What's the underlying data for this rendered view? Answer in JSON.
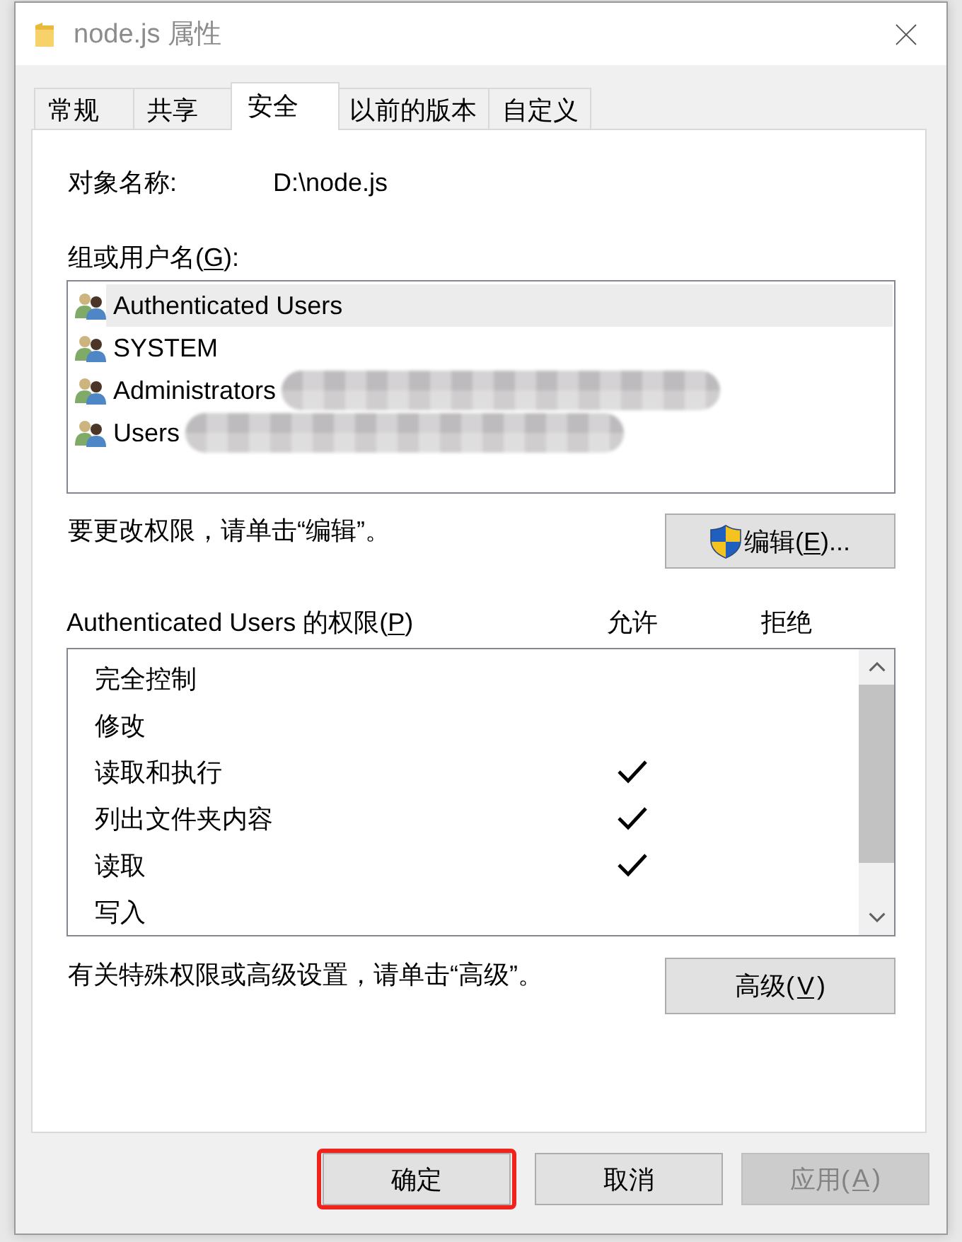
{
  "window": {
    "title": "node.js 属性"
  },
  "tabs": [
    {
      "label": "常规",
      "selected": false
    },
    {
      "label": "共享",
      "selected": false
    },
    {
      "label": "安全",
      "selected": true
    },
    {
      "label": "以前的版本",
      "selected": false
    },
    {
      "label": "自定义",
      "selected": false
    }
  ],
  "object_name": {
    "label": "对象名称:",
    "value": "D:\\node.js"
  },
  "groups": {
    "label": {
      "text_before": "组或用户名(",
      "access_key": "G",
      "text_after": "):"
    },
    "items": [
      {
        "name": "Authenticated Users",
        "selected": true,
        "redacted": false
      },
      {
        "name": "SYSTEM",
        "selected": false,
        "redacted": false
      },
      {
        "name": "Administrators",
        "selected": false,
        "redacted": true
      },
      {
        "name": "Users",
        "selected": false,
        "redacted": true
      }
    ]
  },
  "edit_hint": "要更改权限，请单击“编辑”。",
  "edit_button": {
    "label": {
      "text_before": "编辑(",
      "access_key": "E",
      "text_after": ")..."
    }
  },
  "permissions": {
    "label": {
      "text_before": "Authenticated Users 的权限(",
      "access_key": "P",
      "text_after": ")"
    },
    "columns": [
      "允许",
      "拒绝"
    ],
    "items": [
      {
        "name": "完全控制",
        "allow": false,
        "deny": false
      },
      {
        "name": "修改",
        "allow": false,
        "deny": false
      },
      {
        "name": "读取和执行",
        "allow": true,
        "deny": false
      },
      {
        "name": "列出文件夹内容",
        "allow": true,
        "deny": false
      },
      {
        "name": "读取",
        "allow": true,
        "deny": false
      },
      {
        "name": "写入",
        "allow": false,
        "deny": false
      }
    ]
  },
  "advanced_hint": "有关特殊权限或高级设置，请单击“高级”。",
  "advanced_button": {
    "label": {
      "text_before": "高级(",
      "access_key": "V",
      "text_after": ")"
    }
  },
  "buttons": [
    {
      "label": {
        "text_before": "确定"
      },
      "highlighted": true,
      "disabled": false
    },
    {
      "label": {
        "text_before": "取消"
      },
      "highlighted": false,
      "disabled": false
    },
    {
      "label": {
        "text_before": "应用(",
        "access_key": "A",
        "text_after": ")"
      },
      "highlighted": false,
      "disabled": true
    }
  ]
}
